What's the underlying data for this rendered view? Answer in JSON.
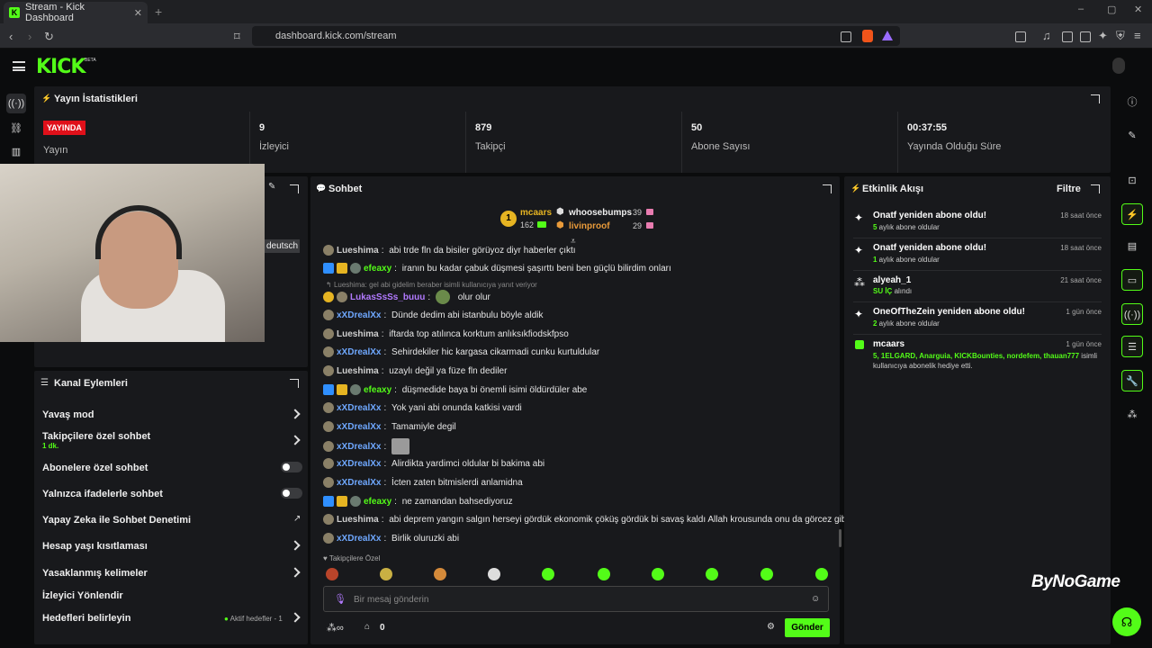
{
  "browser": {
    "tab_title": "Stream - Kick Dashboard",
    "url": "dashboard.kick.com/stream"
  },
  "brand": {
    "beta_badge": "BETA"
  },
  "stats": {
    "title": "Yayın İstatistikleri",
    "live_badge": "YAYINDA",
    "items": [
      {
        "label": "Yayın",
        "value": ""
      },
      {
        "label": "İzleyici",
        "value": "9"
      },
      {
        "label": "Takipçi",
        "value": "879"
      },
      {
        "label": "Abone Sayısı",
        "value": "50"
      },
      {
        "label": "Yayında Olduğu Süre",
        "value": "00:37:55"
      }
    ]
  },
  "webcam": {
    "overlay_label": "deutsch"
  },
  "channel_actions": {
    "title": "Kanal Eylemleri",
    "rows": [
      {
        "label": "Yavaş mod",
        "control": "chevron"
      },
      {
        "label": "Takipçilere özel sohbet",
        "sub": "1 dk.",
        "control": "chevron"
      },
      {
        "label": "Abonelere özel sohbet",
        "control": "toggle"
      },
      {
        "label": "Yalnızca ifadelerle sohbet",
        "control": "toggle"
      },
      {
        "label": "Yapay Zeka ile Sohbet Denetimi",
        "control": "external"
      },
      {
        "label": "Hesap yaşı kısıtlaması",
        "control": "chevron"
      },
      {
        "label": "Yasaklanmış kelimeler",
        "control": "chevron"
      },
      {
        "label": "İzleyici Yönlendir",
        "control": "none"
      },
      {
        "label": "Hedefleri belirleyin",
        "control": "chevron",
        "status": "Aktif hedefler - 1"
      }
    ]
  },
  "chat": {
    "title": "Sohbet",
    "leaderboard": [
      {
        "rank": "1",
        "name": "mcaars",
        "count": "162"
      },
      {
        "name": "whoosebumps",
        "count": "39"
      },
      {
        "name": "livinproof",
        "count": "29"
      }
    ],
    "messages": [
      {
        "user": "Lueshima",
        "color": "#cfcfcf",
        "text": "abi trde fln da bisiler görüyoz diyr haberler çıktı",
        "badges": [
          "sub"
        ]
      },
      {
        "user": "efeaxy",
        "color": "#53fc18",
        "text": "iranın bu kadar çabuk düşmesi şaşırttı beni ben güçlü bilirdim onları",
        "badges": [
          "blue",
          "crown",
          "shield"
        ]
      },
      {
        "reply": "Lueshima: gel abi gidelim beraber isimli kullanıcıya yanıt veriyor",
        "user": "LukasSsSs_buuu",
        "color": "#b27aff",
        "text": "olur olur",
        "badges": [
          "rank",
          "sub"
        ],
        "emote": true
      },
      {
        "user": "xXDrealXx",
        "color": "#6fa8ff",
        "text": "Dünde dedim abi istanbulu böyle aldik",
        "badges": [
          "sub"
        ]
      },
      {
        "user": "Lueshima",
        "color": "#cfcfcf",
        "text": "iftarda top atılınca korktum anlıksıkfiodskfpso",
        "badges": [
          "sub"
        ]
      },
      {
        "user": "xXDrealXx",
        "color": "#6fa8ff",
        "text": "Sehirdekiler hic kargasa cikarmadi cunku kurtuldular",
        "badges": [
          "sub"
        ]
      },
      {
        "user": "Lueshima",
        "color": "#cfcfcf",
        "text": "uzaylı değil ya füze fln dediler",
        "badges": [
          "sub"
        ]
      },
      {
        "user": "efeaxy",
        "color": "#53fc18",
        "text": "düşmedide baya bi önemli isimi öldürdüler abe",
        "badges": [
          "blue",
          "crown",
          "shield"
        ]
      },
      {
        "user": "xXDrealXx",
        "color": "#6fa8ff",
        "text": "Yok yani abi onunda katkisi vardi",
        "badges": [
          "sub"
        ]
      },
      {
        "user": "xXDrealXx",
        "color": "#6fa8ff",
        "text": "Tamamiyle degil",
        "badges": [
          "sub"
        ]
      },
      {
        "user": "xXDrealXx",
        "color": "#6fa8ff",
        "text": "",
        "badges": [
          "sub"
        ],
        "emote": true
      },
      {
        "user": "xXDrealXx",
        "color": "#6fa8ff",
        "text": "Alirdikta yardimci oldular bi bakima abi",
        "badges": [
          "sub"
        ]
      },
      {
        "user": "xXDrealXx",
        "color": "#6fa8ff",
        "text": "İcten zaten bitmislerdi anlamidna",
        "badges": [
          "sub"
        ]
      },
      {
        "user": "efeaxy",
        "color": "#53fc18",
        "text": "ne zamandan bahsediyoruz",
        "badges": [
          "blue",
          "crown",
          "shield"
        ]
      },
      {
        "user": "Lueshima",
        "color": "#cfcfcf",
        "text": "abi deprem yangın salgın herseyi gördük ekonomik çöküş gördük bi savaş kaldı Allah krousunda onu da görcez gibi",
        "badges": [
          "sub"
        ]
      },
      {
        "user": "xXDrealXx",
        "color": "#6fa8ff",
        "text": "Birlik oluruzki abi",
        "badges": [
          "sub"
        ]
      }
    ],
    "followers_only_label": "Takipçilere Özel",
    "input_placeholder": "Bir mesaj gönderin",
    "points_count": "0",
    "send_label": "Gönder"
  },
  "activity": {
    "title": "Etkinlik Akışı",
    "filter_label": "Filtre",
    "items": [
      {
        "title": "Onatf yeniden abone oldu!",
        "num": "5",
        "sub": " aylık abone oldular",
        "time": "18 saat önce",
        "icon": "sparkle"
      },
      {
        "title": "Onatf yeniden abone oldu!",
        "num": "1",
        "sub": " aylık abone oldular",
        "time": "18 saat önce",
        "icon": "sparkle"
      },
      {
        "title": "alyeah_1",
        "num": "SU İÇ",
        "sub": " alındı",
        "time": "21 saat önce",
        "icon": "dots"
      },
      {
        "title": "OneOfTheZein yeniden abone oldu!",
        "num": "2",
        "sub": " aylık abone oldular",
        "time": "1 gün önce",
        "icon": "sparkle"
      },
      {
        "title": "mcaars",
        "num": "5, 1ELGARD, Anarguia, KICKBounties, nordefem, thauan777",
        "sub": " isimli kullanıcıya abonelik hediye etti.",
        "time": "1 gün önce",
        "icon": "gift"
      }
    ]
  },
  "watermark": "ByNoGame",
  "colors": {
    "accent": "#53fc18",
    "live": "#e0101a",
    "panel": "#18191c",
    "bg": "#0b0c0d"
  }
}
